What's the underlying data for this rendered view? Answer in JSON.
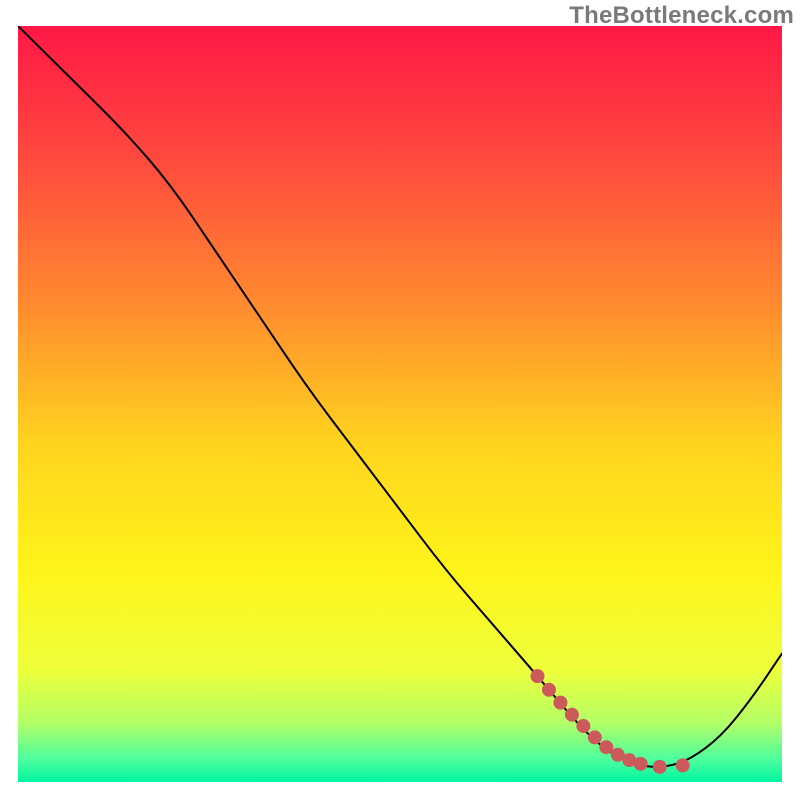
{
  "watermark": "TheBottleneck.com",
  "colors": {
    "curve": "#000000",
    "marker": "#cc5a5a",
    "gradient_top": "#ff1846",
    "gradient_bottom": "#00f5a0"
  },
  "chart_data": {
    "type": "line",
    "title": "",
    "xlabel": "",
    "ylabel": "",
    "xlim": [
      0,
      100
    ],
    "ylim": [
      0,
      100
    ],
    "series": [
      {
        "name": "bottleneck-curve",
        "x": [
          0,
          7,
          14,
          20,
          26,
          32,
          38,
          44,
          50,
          56,
          62,
          68,
          73,
          76,
          79,
          82,
          85,
          88,
          92,
          96,
          100
        ],
        "y": [
          100,
          93,
          86,
          79,
          70,
          61,
          52,
          44,
          36,
          28,
          21,
          14,
          8,
          5,
          3,
          2,
          2,
          3,
          6,
          11,
          17
        ]
      }
    ],
    "markers": [
      {
        "name": "highlight-band",
        "shape": "circle",
        "radius_px": 7,
        "points": [
          {
            "x": 68.0,
            "y": 14.0
          },
          {
            "x": 69.5,
            "y": 12.2
          },
          {
            "x": 71.0,
            "y": 10.5
          },
          {
            "x": 72.5,
            "y": 8.9
          },
          {
            "x": 74.0,
            "y": 7.4
          },
          {
            "x": 75.5,
            "y": 5.9
          },
          {
            "x": 77.0,
            "y": 4.6
          },
          {
            "x": 78.5,
            "y": 3.6
          },
          {
            "x": 80.0,
            "y": 2.9
          },
          {
            "x": 81.5,
            "y": 2.4
          },
          {
            "x": 84.0,
            "y": 2.0
          },
          {
            "x": 87.0,
            "y": 2.2
          }
        ]
      }
    ]
  }
}
